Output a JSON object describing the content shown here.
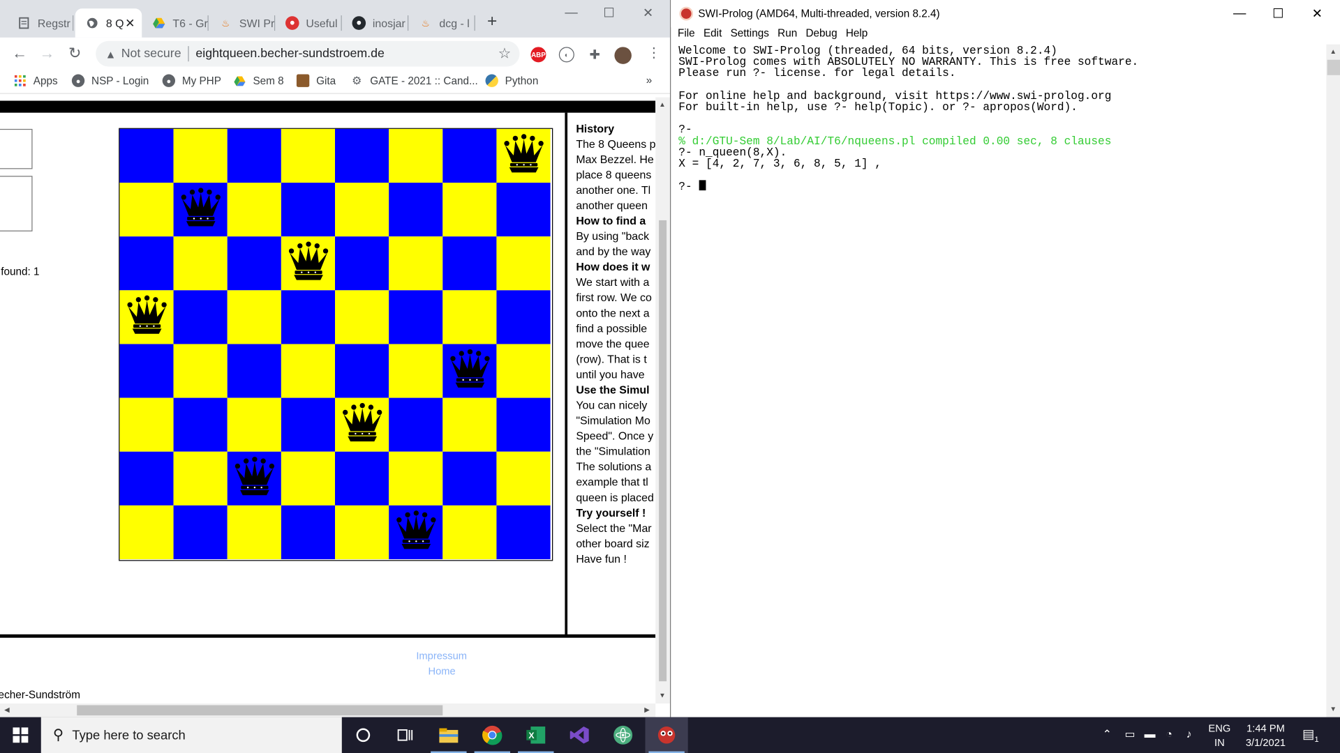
{
  "browser": {
    "tabs": [
      {
        "title": "Regstr",
        "favicon": "document-icon"
      },
      {
        "title": "8 Q",
        "favicon": "globe-icon"
      },
      {
        "title": "T6 - Gr",
        "favicon": "drive-icon"
      },
      {
        "title": "SWI Pr",
        "favicon": "swi-icon"
      },
      {
        "title": "Useful",
        "favicon": "owl-icon"
      },
      {
        "title": "inosjar",
        "favicon": "github-icon"
      },
      {
        "title": "dcg - l",
        "favicon": "swi-icon"
      }
    ],
    "new_tab": "+",
    "security_label": "Not secure",
    "url": "eightqueen.becher-sundstroem.de",
    "extensions": [
      "ABP"
    ],
    "bookmarks_overflow": "»",
    "bookmarks": [
      {
        "label": "Apps",
        "icon": "apps-grid-icon"
      },
      {
        "label": "NSP - Login",
        "icon": "globe-icon"
      },
      {
        "label": "My PHP",
        "icon": "globe-icon"
      },
      {
        "label": "Sem 8",
        "icon": "drive-icon"
      },
      {
        "label": "Gita",
        "icon": "image-icon"
      },
      {
        "label": "GATE - 2021 :: Cand...",
        "icon": "gear-icon"
      },
      {
        "label": "Python",
        "icon": "python-icon"
      }
    ]
  },
  "page": {
    "solutions_found": "found: 1",
    "board": {
      "size": 8,
      "queen_columns_by_row": [
        8,
        2,
        4,
        1,
        7,
        5,
        3,
        6
      ],
      "dark_color": "#0000ff",
      "light_color": "#ffff00"
    },
    "info_lines": [
      {
        "text": "History",
        "bold": true
      },
      {
        "text": "The 8 Queens p",
        "bold": false
      },
      {
        "text": "Max Bezzel. He",
        "bold": false
      },
      {
        "text": "place 8 queens",
        "bold": false
      },
      {
        "text": "another one. Tl",
        "bold": false
      },
      {
        "text": "another queen",
        "bold": false
      },
      {
        "text": "How to find a",
        "bold": true
      },
      {
        "text": "By using \"back",
        "bold": false
      },
      {
        "text": "and by the way",
        "bold": false
      },
      {
        "text": "How does it w",
        "bold": true
      },
      {
        "text": "We start with a",
        "bold": false
      },
      {
        "text": "first row. We co",
        "bold": false
      },
      {
        "text": "onto the next a",
        "bold": false
      },
      {
        "text": "find a possible",
        "bold": false
      },
      {
        "text": "move the quee",
        "bold": false
      },
      {
        "text": "(row). That is t",
        "bold": false
      },
      {
        "text": "until you have",
        "bold": false
      },
      {
        "text": "Use the Simul",
        "bold": true
      },
      {
        "text": "You can nicely",
        "bold": false
      },
      {
        "text": "\"Simulation Mo",
        "bold": false
      },
      {
        "text": "Speed\". Once y",
        "bold": false
      },
      {
        "text": "the \"Simulation",
        "bold": false
      },
      {
        "text": "The solutions a",
        "bold": false
      },
      {
        "text": "example that tl",
        "bold": false
      },
      {
        "text": "queen is placed",
        "bold": false
      },
      {
        "text": "Try yourself !",
        "bold": true
      },
      {
        "text": "Select the \"Mar",
        "bold": false
      },
      {
        "text": "other board siz",
        "bold": false
      },
      {
        "text": "Have fun !",
        "bold": false
      }
    ],
    "footer_links": [
      "Impressum",
      "Home"
    ],
    "footer_name": "echer-Sundström"
  },
  "prolog": {
    "title": "SWI-Prolog (AMD64, Multi-threaded, version 8.2.4)",
    "menu": [
      "File",
      "Edit",
      "Settings",
      "Run",
      "Debug",
      "Help"
    ],
    "console": [
      {
        "text": "Welcome to SWI-Prolog (threaded, 64 bits, version 8.2.4)",
        "color": "black"
      },
      {
        "text": "SWI-Prolog comes with ABSOLUTELY NO WARRANTY. This is free software.",
        "color": "black"
      },
      {
        "text": "Please run ?- license. for legal details.",
        "color": "black"
      },
      {
        "text": "",
        "color": "black"
      },
      {
        "text": "For online help and background, visit https://www.swi-prolog.org",
        "color": "black"
      },
      {
        "text": "For built-in help, use ?- help(Topic). or ?- apropos(Word).",
        "color": "black"
      },
      {
        "text": "",
        "color": "black"
      },
      {
        "text": "?-",
        "color": "black"
      },
      {
        "text": "% d:/GTU-Sem 8/Lab/AI/T6/nqueens.pl compiled 0.00 sec, 8 clauses",
        "color": "green"
      },
      {
        "text": "?- n_queen(8,X).",
        "color": "black"
      },
      {
        "text": "X = [4, 2, 7, 3, 6, 8, 5, 1] ,",
        "color": "black"
      },
      {
        "text": "",
        "color": "black"
      }
    ],
    "prompt": "?- "
  },
  "taskbar": {
    "search_placeholder": "Type here to search",
    "language": "ENG",
    "region": "IN",
    "time": "1:44 PM",
    "date": "3/1/2021",
    "notification_count": "1"
  }
}
